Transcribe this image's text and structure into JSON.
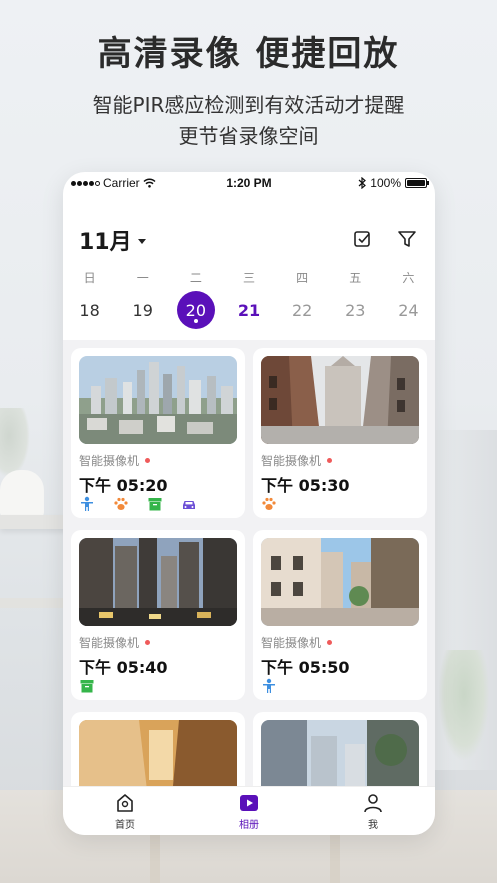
{
  "promo": {
    "headline": "高清录像 便捷回放",
    "subline_1": "智能PIR感应检测到有效活动才提醒",
    "subline_2": "更节省录像空间"
  },
  "status_bar": {
    "carrier": "Carrier",
    "time": "1:20 PM",
    "battery": "100%"
  },
  "calendar": {
    "month_label": "11月",
    "weekdays": [
      "日",
      "一",
      "二",
      "三",
      "四",
      "五",
      "六"
    ],
    "dates": [
      "18",
      "19",
      "20",
      "21",
      "22",
      "23",
      "24"
    ],
    "selected_date": "20",
    "today": "21"
  },
  "recordings": [
    {
      "camera": "智能摄像机",
      "time": "下午 05:20",
      "events": [
        "person-icon",
        "pet-icon",
        "package-icon",
        "vehicle-icon"
      ]
    },
    {
      "camera": "智能摄像机",
      "time": "下午 05:30",
      "events": [
        "pet-icon"
      ]
    },
    {
      "camera": "智能摄像机",
      "time": "下午 05:40",
      "events": [
        "package-icon"
      ]
    },
    {
      "camera": "智能摄像机",
      "time": "下午 05:50",
      "events": [
        "person-icon"
      ]
    },
    {
      "camera": "",
      "time": "",
      "events": []
    },
    {
      "camera": "",
      "time": "",
      "events": []
    }
  ],
  "tabbar": {
    "home": "首页",
    "album": "相册",
    "me": "我"
  },
  "colors": {
    "accent": "#5a10b9",
    "person": "#3d8fe0",
    "pet": "#f2893a",
    "package": "#35b54a",
    "vehicle": "#6c4fd6",
    "alert_dot": "#ef5a5a"
  }
}
